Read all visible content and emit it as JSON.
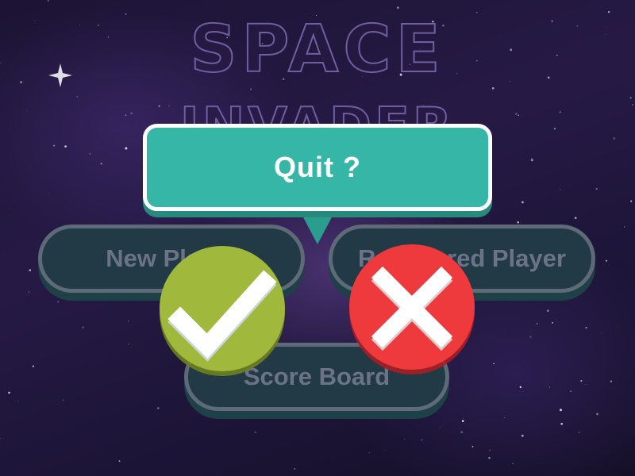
{
  "game": {
    "title_line1": "SPACE",
    "title_line2": "INVADER"
  },
  "menu": {
    "new_player_label": "New Player",
    "registered_player_label": "Registered Player",
    "score_board_label": "Score Board"
  },
  "dialog": {
    "title": "Quit ?",
    "confirm_icon": "check-icon",
    "cancel_icon": "close-icon"
  },
  "colors": {
    "dialog_background": "#35b6a6",
    "confirm_button": "#a0b83b",
    "cancel_button": "#ee3a3c",
    "menu_button": "#223a46",
    "menu_text": "#6b7486"
  }
}
